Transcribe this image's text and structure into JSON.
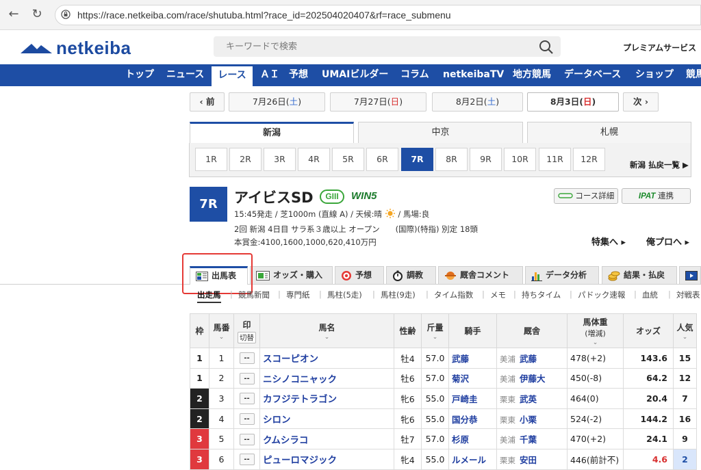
{
  "browser": {
    "url": "https://race.netkeiba.com/race/shutuba.html?race_id=202504020407&rf=race_submenu"
  },
  "header": {
    "logo_text": "netkeiba",
    "search_placeholder": "キーワードで検索",
    "premium": "プレミアムサービス"
  },
  "nav": [
    "トップ",
    "ニュース",
    "レース",
    "ＡＩ",
    "予想",
    "UMAIビルダー",
    "コラム",
    "netkeibaTV",
    "地方競馬",
    "データベース",
    "ショップ",
    "競馬"
  ],
  "nav_active": "レース",
  "dates": {
    "prev": "‹  前",
    "next": "次  ›",
    "items": [
      {
        "main": "7月26日(",
        "day": "土",
        "close": ")",
        "cls": "sat"
      },
      {
        "main": "7月27日(",
        "day": "日",
        "close": ")",
        "cls": "sun"
      },
      {
        "main": "8月2日(",
        "day": "土",
        "close": ")",
        "cls": "sat"
      },
      {
        "main": "8月3日(",
        "day": "日",
        "close": ")",
        "cls": "sun"
      }
    ]
  },
  "venues": [
    "新潟",
    "中京",
    "札幌"
  ],
  "races": [
    "1R",
    "2R",
    "3R",
    "4R",
    "5R",
    "6R",
    "7R",
    "8R",
    "9R",
    "10R",
    "11R",
    "12R"
  ],
  "race_list_link": "新潟 払戻一覧 ▶",
  "race": {
    "number": "7R",
    "name": "アイビスSD",
    "grade": "GIII",
    "win5": "WIN5",
    "line1": "15:45発走 / 芝1000m (直線 A) / 天候:晴",
    "line1b": "/ 馬場:良",
    "line2": "2回 新潟 4日目 サラ系３歳以上 オープン　　(国際)(特指) 別定 18頭",
    "line3": "本賞金:4100,1600,1000,620,410万円",
    "course_btn": "コース詳細",
    "ipat_btn": "IPAT",
    "ipat_link": "連携",
    "tokushu": "特集へ ▸",
    "orepro": "俺プロへ ▸"
  },
  "tabs": [
    "出馬表",
    "オッズ・購入",
    "予想",
    "調教",
    "厩舎コメント",
    "データ分析",
    "結果・払戻"
  ],
  "subnav": [
    "出走馬",
    "競馬新聞",
    "専門紙",
    "馬柱(5走)",
    "馬柱(9走)",
    "タイム指数",
    "メモ",
    "持ちタイム",
    "パドック速報",
    "血統",
    "対戦表"
  ],
  "table": {
    "headers": {
      "waku": "枠",
      "umaban": "馬番",
      "mark": "印",
      "kirikae": "切替",
      "name": "馬名",
      "sexage": "性齢",
      "weight": "斤量",
      "jockey": "騎手",
      "trainer": "厩舎",
      "bodyweight": "馬体重",
      "bw_change": "(増減)",
      "odds": "オッズ",
      "pop": "人気"
    },
    "rows": [
      {
        "waku": "1",
        "waku_cls": "waku1",
        "num": "1",
        "mark": "--",
        "name": "スコーピオン",
        "sexage": "牡4",
        "weight": "57.0",
        "jockey": "武藤",
        "aff": "美浦",
        "trainer": "武藤",
        "bw": "478(+2)",
        "odds": "143.6",
        "pop": "15",
        "hot": false
      },
      {
        "waku": "1",
        "waku_cls": "waku1",
        "num": "2",
        "mark": "--",
        "name": "ニシノコニャック",
        "sexage": "牡6",
        "weight": "57.0",
        "jockey": "菊沢",
        "aff": "美浦",
        "trainer": "伊藤大",
        "bw": "450(-8)",
        "odds": "64.2",
        "pop": "12",
        "hot": false
      },
      {
        "waku": "2",
        "waku_cls": "waku2",
        "num": "3",
        "mark": "--",
        "name": "カフジテトラゴン",
        "sexage": "牝6",
        "weight": "55.0",
        "jockey": "戸崎圭",
        "aff": "栗東",
        "trainer": "武英",
        "bw": "464(0)",
        "odds": "20.4",
        "pop": "7",
        "hot": false
      },
      {
        "waku": "2",
        "waku_cls": "waku2",
        "num": "4",
        "mark": "--",
        "name": "シロン",
        "sexage": "牝6",
        "weight": "55.0",
        "jockey": "国分恭",
        "aff": "栗東",
        "trainer": "小栗",
        "bw": "524(-2)",
        "odds": "144.2",
        "pop": "16",
        "hot": false
      },
      {
        "waku": "3",
        "waku_cls": "waku3",
        "num": "5",
        "mark": "--",
        "name": "クムシラコ",
        "sexage": "牡7",
        "weight": "57.0",
        "jockey": "杉原",
        "aff": "美浦",
        "trainer": "千葉",
        "bw": "470(+2)",
        "odds": "24.1",
        "pop": "9",
        "hot": false
      },
      {
        "waku": "3",
        "waku_cls": "waku3",
        "num": "6",
        "mark": "--",
        "name": "ピューロマジック",
        "sexage": "牝4",
        "weight": "55.0",
        "jockey": "ルメール",
        "aff": "栗東",
        "trainer": "安田",
        "bw": "446(前計不)",
        "odds": "4.6",
        "pop": "2",
        "hot": true
      }
    ]
  },
  "colors": {
    "brand_blue": "#1e4ea5",
    "highlight_red": "#e53935",
    "grade_green": "#3aa63a"
  }
}
